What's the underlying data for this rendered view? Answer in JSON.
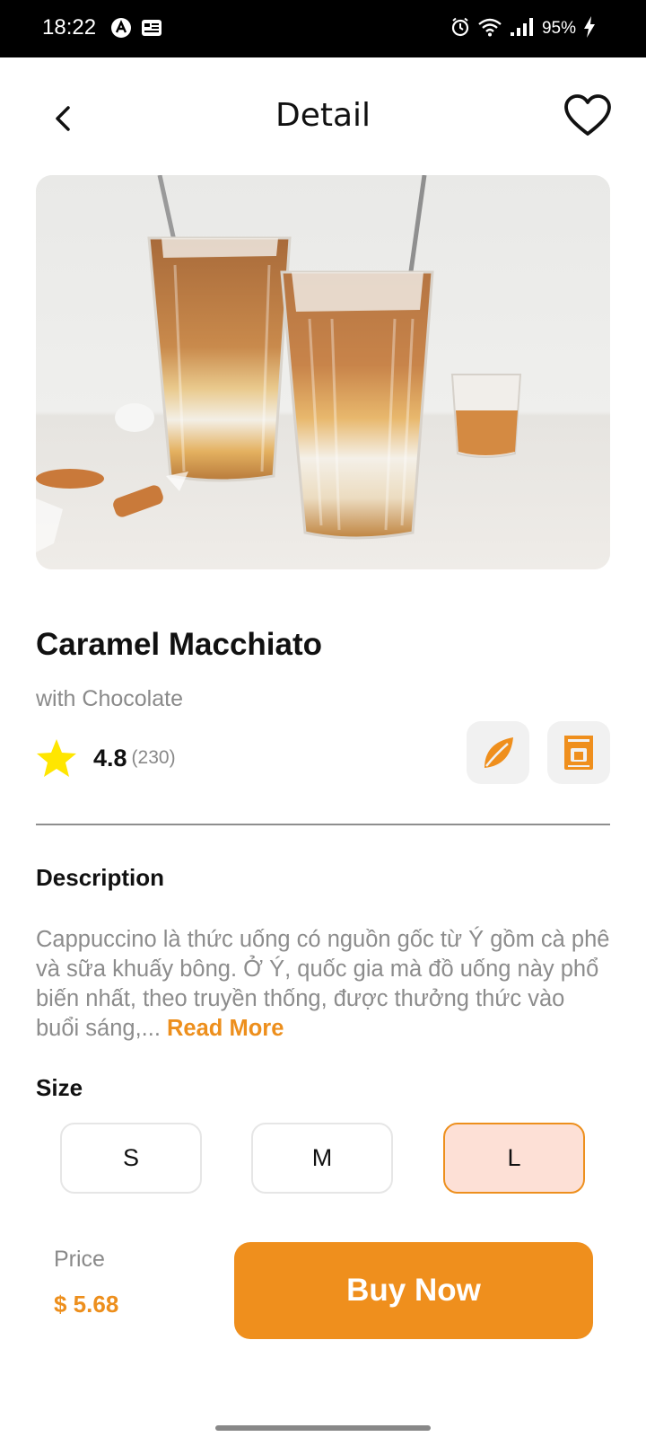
{
  "status_bar": {
    "time": "18:22",
    "battery": "95%",
    "icons": [
      "alarm-icon",
      "wifi-icon",
      "signal-icon",
      "charging-icon"
    ]
  },
  "header": {
    "title": "Detail",
    "back_icon": "chevron-left-icon",
    "favorite_icon": "heart-outline-icon"
  },
  "product": {
    "name": "Caramel Macchiato",
    "subtitle": "with Chocolate",
    "rating": "4.8",
    "rating_count": "(230)",
    "feature_icons": [
      "leaf-icon",
      "coffee-machine-icon"
    ]
  },
  "description": {
    "title": "Description",
    "text": "Cappuccino là thức uống có nguồn gốc từ Ý gồm cà phê và sữa khuấy bông. Ở Ý, quốc gia mà đồ uống này phổ biến nhất, theo truyền thống, được thưởng thức vào buổi sáng,... ",
    "read_more": "Read More"
  },
  "size": {
    "title": "Size",
    "options": [
      "S",
      "M",
      "L"
    ],
    "selected": "L"
  },
  "purchase": {
    "price_label": "Price",
    "price": "$ 5.68",
    "buy_label": "Buy Now"
  },
  "colors": {
    "accent": "#ef8f1d",
    "selected_bg": "#fde0d6",
    "star": "#ffe600"
  }
}
